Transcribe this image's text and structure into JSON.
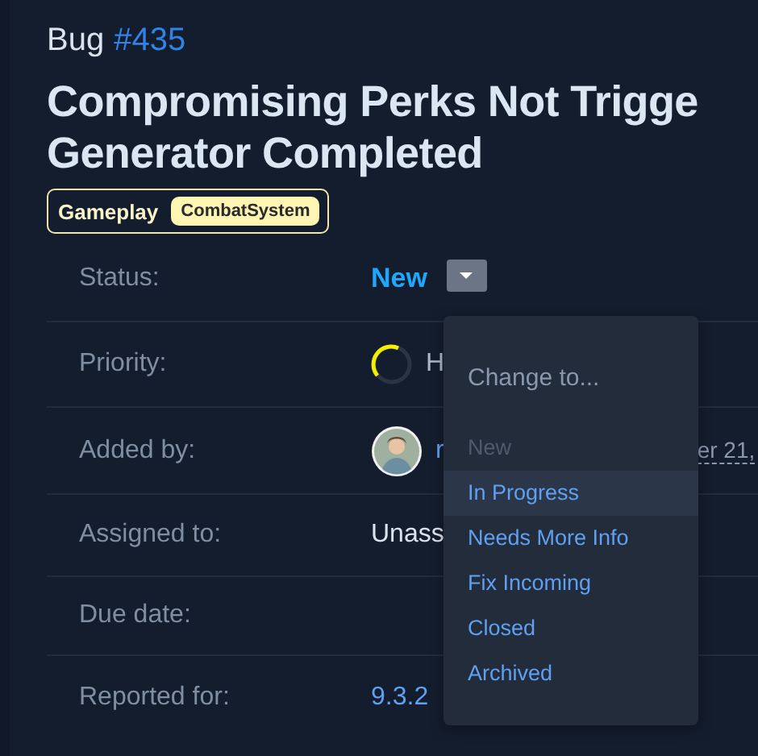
{
  "issue": {
    "type": "Bug",
    "number": "#435"
  },
  "title_lines": [
    "Compromising Perks Not Trigge",
    "Generator Completed"
  ],
  "tags": [
    {
      "label": "Gameplay",
      "kind": "plain"
    },
    {
      "label": "CombatSystem",
      "kind": "pill"
    }
  ],
  "fields": [
    {
      "label": "Status:",
      "kind": "status",
      "value": "New"
    },
    {
      "label": "Priority:",
      "kind": "priority",
      "value": "H"
    },
    {
      "label": "Added by:",
      "kind": "user",
      "name": "r",
      "date": "er 21,"
    },
    {
      "label": "Assigned to:",
      "kind": "text",
      "value": "Unass"
    },
    {
      "label": "Due date:",
      "kind": "empty"
    },
    {
      "label": "Reported for:",
      "kind": "link",
      "value": "9.3.2"
    }
  ],
  "status_menu": {
    "heading": "Change to...",
    "items": [
      {
        "label": "New",
        "disabled": true,
        "highlighted": false
      },
      {
        "label": "In Progress",
        "disabled": false,
        "highlighted": true
      },
      {
        "label": "Needs More Info",
        "disabled": false,
        "highlighted": false
      },
      {
        "label": "Fix Incoming",
        "disabled": false,
        "highlighted": false
      },
      {
        "label": "Closed",
        "disabled": false,
        "highlighted": false
      },
      {
        "label": "Archived",
        "disabled": false,
        "highlighted": false
      }
    ]
  }
}
